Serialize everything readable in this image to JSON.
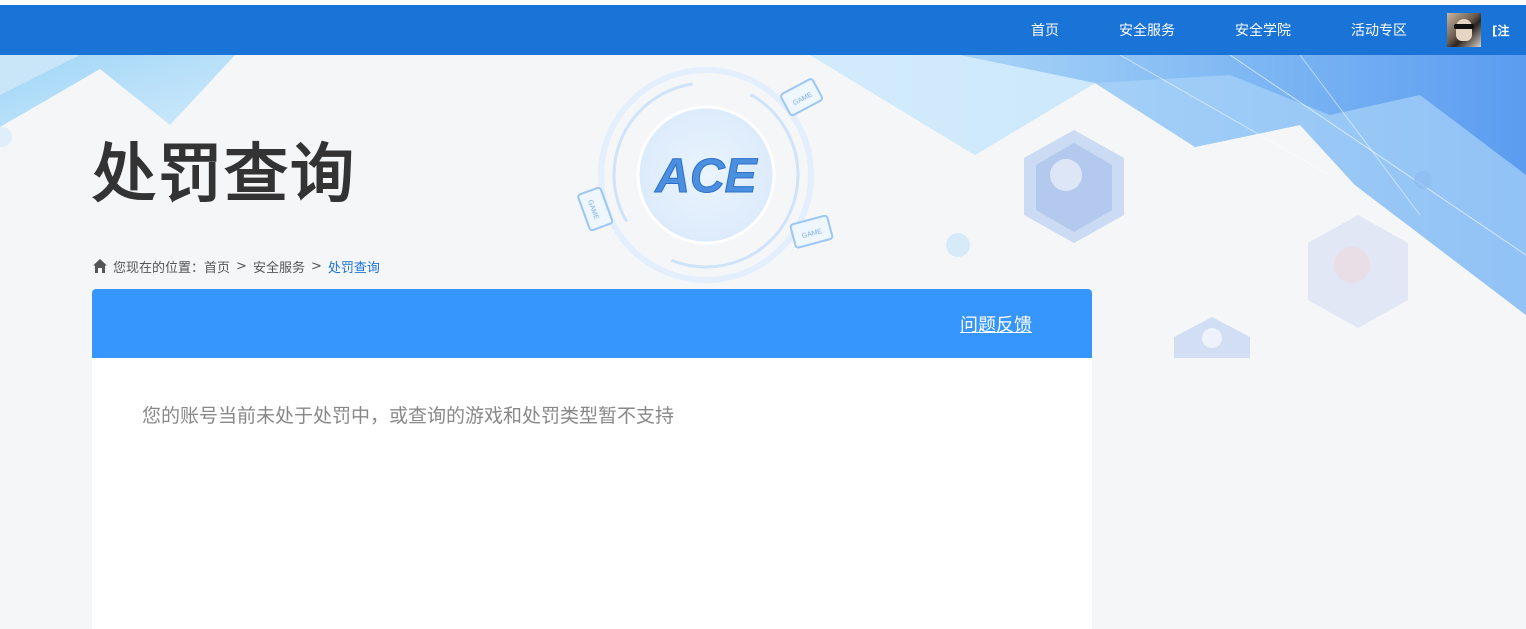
{
  "nav": {
    "items": [
      {
        "label": "首页"
      },
      {
        "label": "安全服务"
      },
      {
        "label": "安全学院"
      },
      {
        "label": "活动专区"
      }
    ],
    "logout_label": "[注销]"
  },
  "banner": {
    "logo_text": "ACE",
    "game_badge": "GAME"
  },
  "page": {
    "title": "处罚查询"
  },
  "breadcrumb": {
    "prefix": "您现在的位置：",
    "items": [
      "首页",
      "安全服务",
      "处罚查询"
    ],
    "separator": ">"
  },
  "panel": {
    "feedback_label": "问题反馈",
    "message": "您的账号当前未处于处罚中，或查询的游戏和处罚类型暂不支持"
  },
  "colors": {
    "nav_bg": "#1a73d6",
    "panel_header": "#3796fd",
    "breadcrumb_current": "#1a73d6",
    "page_bg": "#f5f6f8"
  }
}
